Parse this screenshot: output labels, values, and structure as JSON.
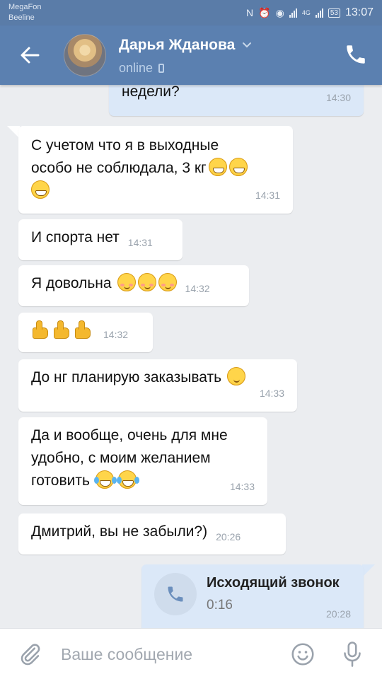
{
  "status_bar": {
    "carrier_1": "MegaFon",
    "carrier_2": "Beeline",
    "network": "4G",
    "battery": "53",
    "clock": "13:07"
  },
  "header": {
    "contact_name": "Дарья Жданова",
    "contact_status": "online",
    "back_icon": "back-arrow-icon",
    "call_icon": "phone-icon"
  },
  "messages": [
    {
      "direction": "out",
      "text": "недели?",
      "time": "14:30"
    },
    {
      "direction": "in",
      "line1": "С учетом что я в выходные",
      "line2": "особо не соблюдала, 3 кг",
      "emojis": [
        "grin",
        "grin",
        "grin"
      ],
      "time": "14:31"
    },
    {
      "direction": "in",
      "text": "И спорта нет",
      "time": "14:31"
    },
    {
      "direction": "in",
      "text": "Я довольна",
      "emojis": [
        "blush",
        "blush",
        "blush"
      ],
      "time": "14:32"
    },
    {
      "direction": "in",
      "emojis": [
        "thumbs-up",
        "thumbs-up",
        "thumbs-up"
      ],
      "time": "14:32"
    },
    {
      "direction": "in",
      "text": "До нг планирую заказывать",
      "emojis": [
        "wink"
      ],
      "time": "14:33"
    },
    {
      "direction": "in",
      "line1": "Да и вообще, очень для мне",
      "line2": "удобно, с моим желанием",
      "line3": "готовить",
      "emojis": [
        "joy",
        "joy"
      ],
      "time": "14:33"
    },
    {
      "direction": "in",
      "text": "Дмитрий, вы не забыли?)",
      "time": "20:26"
    },
    {
      "direction": "out",
      "type": "call",
      "title": "Исходящий звонок",
      "duration": "0:16",
      "time": "20:28"
    }
  ],
  "composer": {
    "placeholder": "Ваше сообщение",
    "value": ""
  },
  "colors": {
    "header": "#5b80b0",
    "chat_bg": "#ebedf0",
    "incoming": "#ffffff",
    "outgoing": "#dbe8f8"
  }
}
